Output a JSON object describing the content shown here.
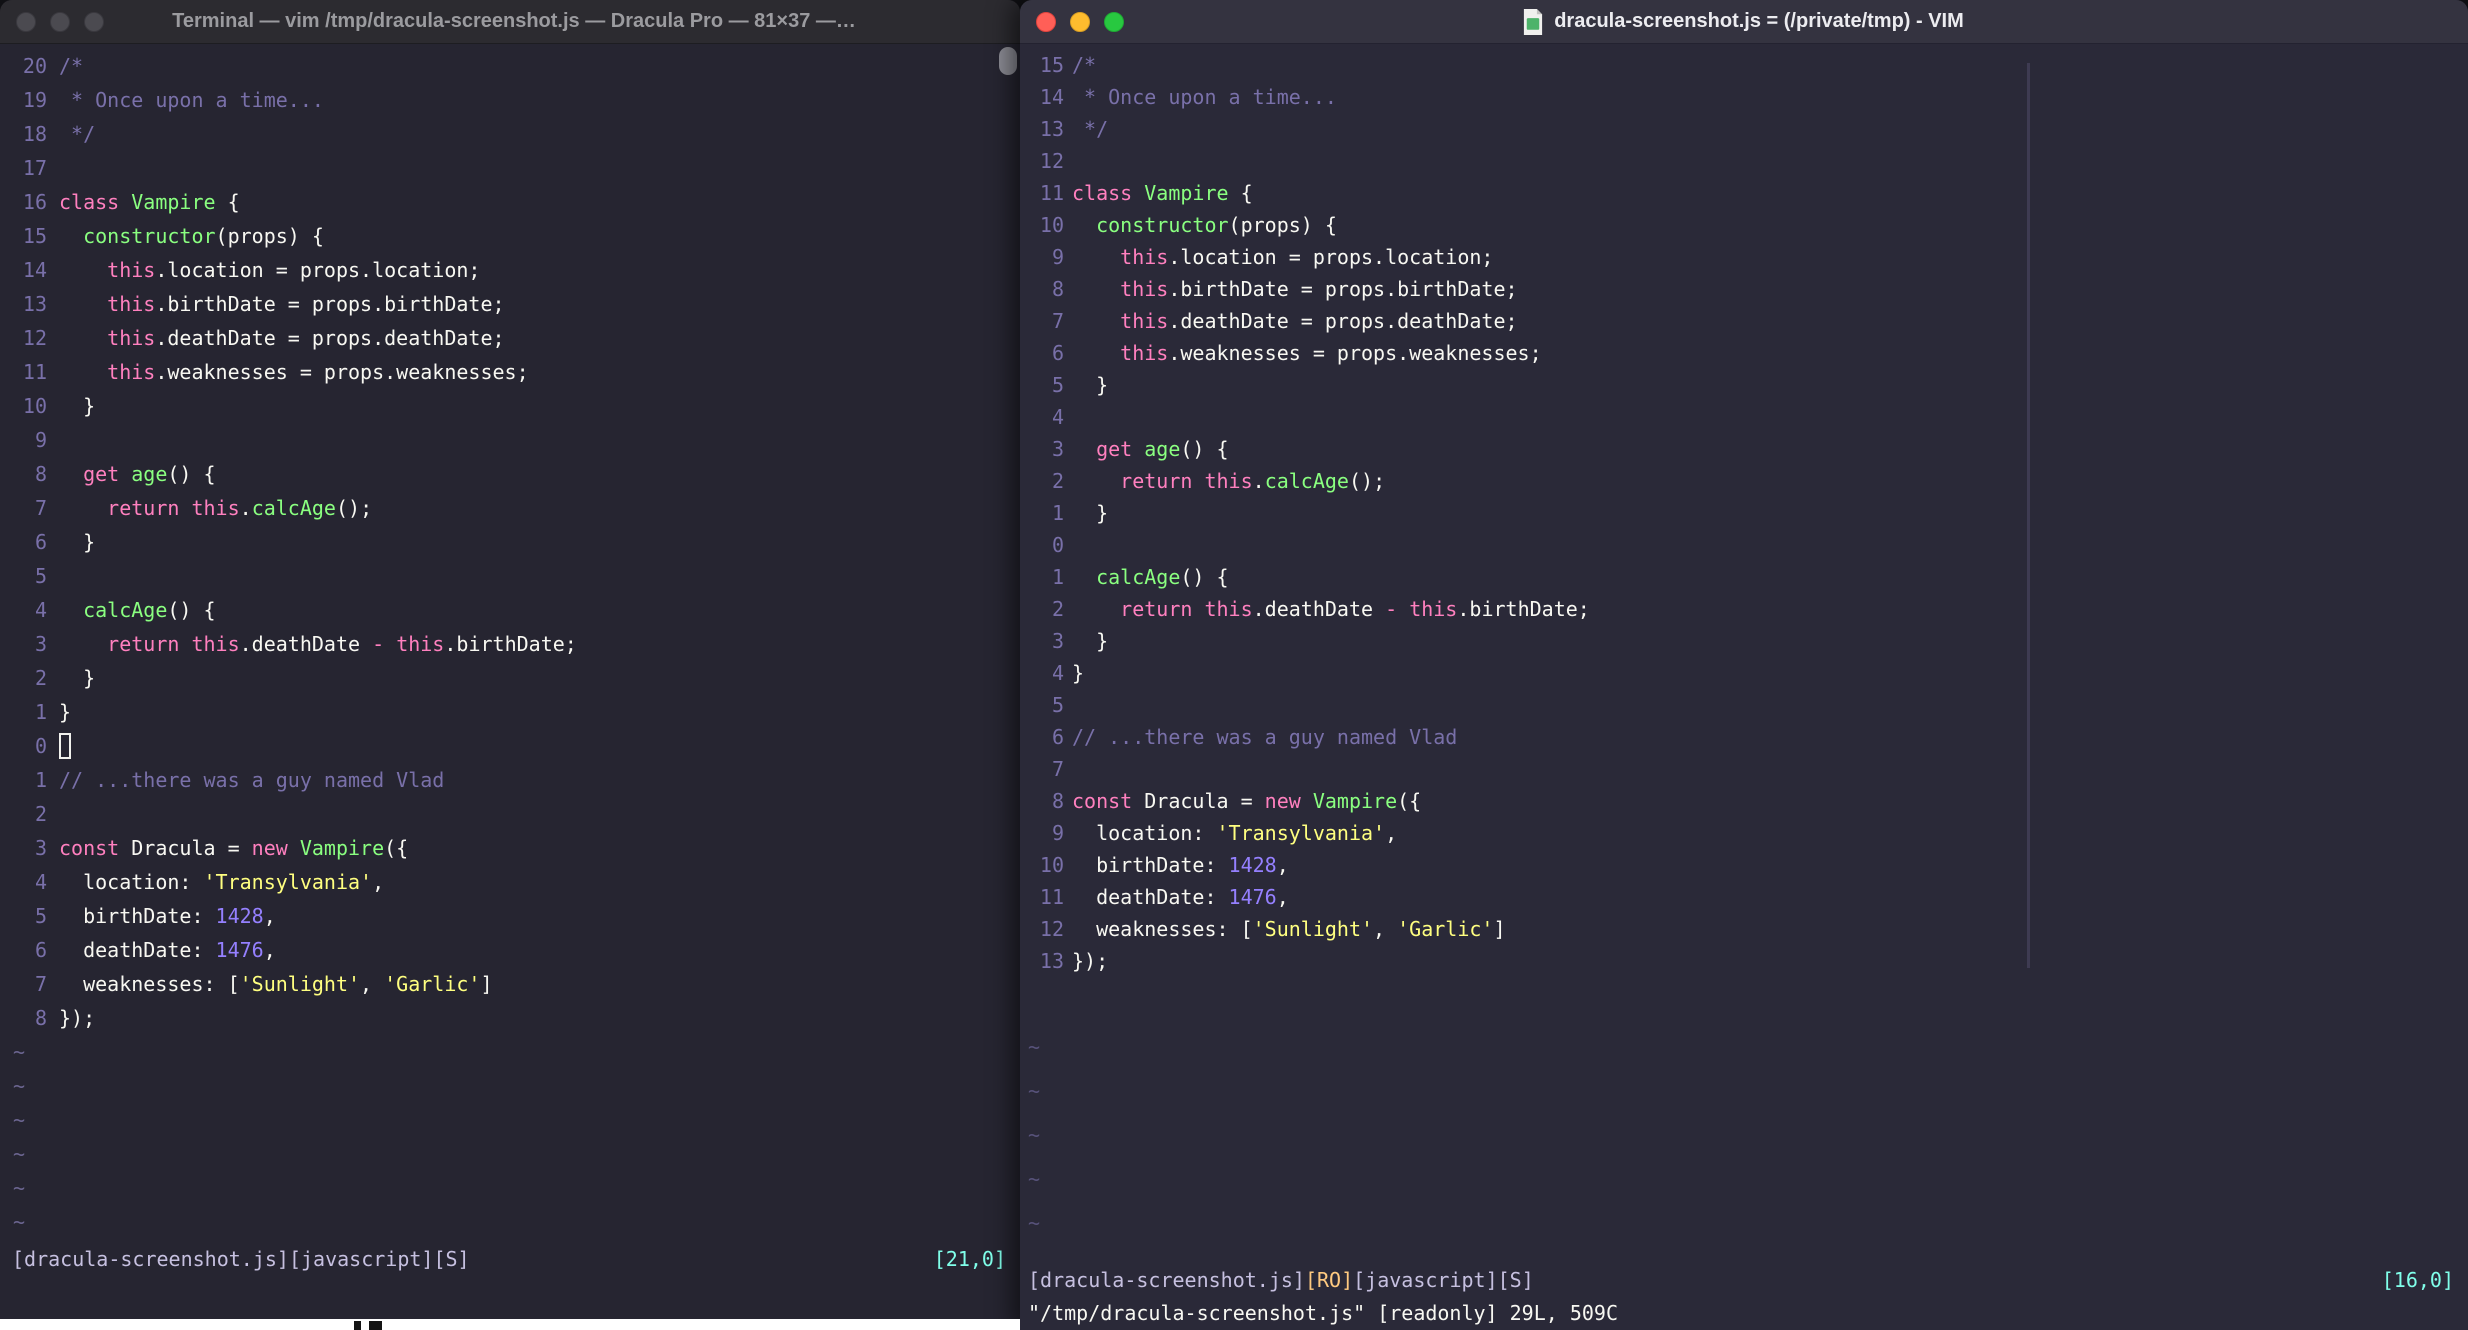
{
  "palette": {
    "background_left": "#262531",
    "background_right": "#2a2938",
    "foreground": "#f8f8f2",
    "comment": "#7970a9",
    "pink": "#ff80bf",
    "green": "#8aff80",
    "yellow": "#ffff80",
    "purple": "#9580ff",
    "cyan": "#80ffea",
    "orange": "#ffca80",
    "line_number": "#7970a9"
  },
  "left_window": {
    "titlebar_title": "Terminal — vim /tmp/dracula-screenshot.js — Dracula Pro — 81×37 —…",
    "position": "[21,0]",
    "status_segments": [
      [
        "st",
        "[dracula-screenshot.js]"
      ],
      [
        "st",
        "[javascript]"
      ],
      [
        "st",
        "[S]"
      ]
    ],
    "lines": [
      {
        "n": "20",
        "s": [
          [
            "c",
            "/*"
          ]
        ]
      },
      {
        "n": "19",
        "s": [
          [
            "c",
            " * Once upon a time..."
          ]
        ]
      },
      {
        "n": "18",
        "s": [
          [
            "c",
            " */"
          ]
        ]
      },
      {
        "n": "17",
        "s": []
      },
      {
        "n": "16",
        "s": [
          [
            "k",
            "class"
          ],
          [
            "t",
            " "
          ],
          [
            "f",
            "Vampire"
          ],
          [
            "t",
            " {"
          ]
        ]
      },
      {
        "n": "15",
        "s": [
          [
            "t",
            "  "
          ],
          [
            "f",
            "constructor"
          ],
          [
            "t",
            "(props) {"
          ]
        ]
      },
      {
        "n": "14",
        "s": [
          [
            "t",
            "    "
          ],
          [
            "k",
            "this"
          ],
          [
            "t",
            ".location = props.location;"
          ]
        ]
      },
      {
        "n": "13",
        "s": [
          [
            "t",
            "    "
          ],
          [
            "k",
            "this"
          ],
          [
            "t",
            ".birthDate = props.birthDate;"
          ]
        ]
      },
      {
        "n": "12",
        "s": [
          [
            "t",
            "    "
          ],
          [
            "k",
            "this"
          ],
          [
            "t",
            ".deathDate = props.deathDate;"
          ]
        ]
      },
      {
        "n": "11",
        "s": [
          [
            "t",
            "    "
          ],
          [
            "k",
            "this"
          ],
          [
            "t",
            ".weaknesses = props.weaknesses;"
          ]
        ]
      },
      {
        "n": "10",
        "s": [
          [
            "t",
            "  }"
          ]
        ]
      },
      {
        "n": "9",
        "s": []
      },
      {
        "n": "8",
        "s": [
          [
            "t",
            "  "
          ],
          [
            "k",
            "get"
          ],
          [
            "t",
            " "
          ],
          [
            "f",
            "age"
          ],
          [
            "t",
            "() {"
          ]
        ]
      },
      {
        "n": "7",
        "s": [
          [
            "t",
            "    "
          ],
          [
            "k",
            "return"
          ],
          [
            "t",
            " "
          ],
          [
            "k",
            "this"
          ],
          [
            "t",
            "."
          ],
          [
            "f",
            "calcAge"
          ],
          [
            "t",
            "();"
          ]
        ]
      },
      {
        "n": "6",
        "s": [
          [
            "t",
            "  }"
          ]
        ]
      },
      {
        "n": "5",
        "s": []
      },
      {
        "n": "4",
        "s": [
          [
            "t",
            "  "
          ],
          [
            "f",
            "calcAge"
          ],
          [
            "t",
            "() {"
          ]
        ]
      },
      {
        "n": "3",
        "s": [
          [
            "t",
            "    "
          ],
          [
            "k",
            "return"
          ],
          [
            "t",
            " "
          ],
          [
            "k",
            "this"
          ],
          [
            "t",
            ".deathDate "
          ],
          [
            "k",
            "-"
          ],
          [
            "t",
            " "
          ],
          [
            "k",
            "this"
          ],
          [
            "t",
            ".birthDate;"
          ]
        ]
      },
      {
        "n": "2",
        "s": [
          [
            "t",
            "  }"
          ]
        ]
      },
      {
        "n": "1",
        "s": [
          [
            "t",
            "}"
          ]
        ]
      },
      {
        "n": "0",
        "s": [],
        "cursor": "hollow"
      },
      {
        "n": "1",
        "s": [
          [
            "c",
            "// ...there was a guy named Vlad"
          ]
        ]
      },
      {
        "n": "2",
        "s": []
      },
      {
        "n": "3",
        "s": [
          [
            "k",
            "const"
          ],
          [
            "t",
            " Dracula = "
          ],
          [
            "k",
            "new"
          ],
          [
            "t",
            " "
          ],
          [
            "f",
            "Vampire"
          ],
          [
            "t",
            "({"
          ]
        ]
      },
      {
        "n": "4",
        "s": [
          [
            "t",
            "  location: "
          ],
          [
            "str",
            "'Transylvania'"
          ],
          [
            "t",
            ","
          ]
        ]
      },
      {
        "n": "5",
        "s": [
          [
            "t",
            "  birthDate: "
          ],
          [
            "num",
            "1428"
          ],
          [
            "t",
            ","
          ]
        ]
      },
      {
        "n": "6",
        "s": [
          [
            "t",
            "  deathDate: "
          ],
          [
            "num",
            "1476"
          ],
          [
            "t",
            ","
          ]
        ]
      },
      {
        "n": "7",
        "s": [
          [
            "t",
            "  weaknesses: ["
          ],
          [
            "str",
            "'Sunlight'"
          ],
          [
            "t",
            ", "
          ],
          [
            "str",
            "'Garlic'"
          ],
          [
            "t",
            "]"
          ]
        ]
      },
      {
        "n": "8",
        "s": [
          [
            "t",
            "});"
          ]
        ]
      },
      {
        "tilde": true
      },
      {
        "tilde": true
      },
      {
        "tilde": true
      },
      {
        "tilde": true
      },
      {
        "tilde": true
      },
      {
        "tilde": true
      }
    ]
  },
  "right_window": {
    "titlebar_title": "dracula-screenshot.js = (/private/tmp) - VIM",
    "position": "[16,0]",
    "status_segments": [
      [
        "st",
        "[dracula-screenshot.js]"
      ],
      [
        "ro",
        "[RO]"
      ],
      [
        "st",
        "[javascript]"
      ],
      [
        "st",
        "[S]"
      ]
    ],
    "cmdline": "\"/tmp/dracula-screenshot.js\" [readonly] 29L, 509C",
    "tilde_count": 5,
    "lines": [
      {
        "n": "15",
        "s": [
          [
            "c",
            "/*"
          ]
        ]
      },
      {
        "n": "14",
        "s": [
          [
            "c",
            " * Once upon a time..."
          ]
        ]
      },
      {
        "n": "13",
        "s": [
          [
            "c",
            " */"
          ]
        ]
      },
      {
        "n": "12",
        "s": []
      },
      {
        "n": "11",
        "s": [
          [
            "k",
            "class"
          ],
          [
            "t",
            " "
          ],
          [
            "f",
            "Vampire"
          ],
          [
            "t",
            " {"
          ]
        ]
      },
      {
        "n": "10",
        "s": [
          [
            "t",
            "  "
          ],
          [
            "f",
            "constructor"
          ],
          [
            "t",
            "(props) {"
          ]
        ]
      },
      {
        "n": "9",
        "s": [
          [
            "t",
            "    "
          ],
          [
            "k",
            "this"
          ],
          [
            "t",
            ".location = props.location;"
          ]
        ]
      },
      {
        "n": "8",
        "s": [
          [
            "t",
            "    "
          ],
          [
            "k",
            "this"
          ],
          [
            "t",
            ".birthDate = props.birthDate;"
          ]
        ]
      },
      {
        "n": "7",
        "s": [
          [
            "t",
            "    "
          ],
          [
            "k",
            "this"
          ],
          [
            "t",
            ".deathDate = props.deathDate;"
          ]
        ]
      },
      {
        "n": "6",
        "s": [
          [
            "t",
            "    "
          ],
          [
            "k",
            "this"
          ],
          [
            "t",
            ".weaknesses = props.weaknesses;"
          ]
        ]
      },
      {
        "n": "5",
        "s": [
          [
            "t",
            "  }"
          ]
        ]
      },
      {
        "n": "4",
        "s": []
      },
      {
        "n": "3",
        "s": [
          [
            "t",
            "  "
          ],
          [
            "k",
            "get"
          ],
          [
            "t",
            " "
          ],
          [
            "f",
            "age"
          ],
          [
            "t",
            "() {"
          ]
        ]
      },
      {
        "n": "2",
        "s": [
          [
            "t",
            "    "
          ],
          [
            "k",
            "return"
          ],
          [
            "t",
            " "
          ],
          [
            "k",
            "this"
          ],
          [
            "t",
            "."
          ],
          [
            "f",
            "calcAge"
          ],
          [
            "t",
            "();"
          ]
        ]
      },
      {
        "n": "1",
        "s": [
          [
            "t",
            "  }"
          ]
        ]
      },
      {
        "n": "0",
        "s": []
      },
      {
        "n": "1",
        "s": [
          [
            "t",
            "  "
          ],
          [
            "f",
            "calcAge"
          ],
          [
            "t",
            "() {"
          ]
        ]
      },
      {
        "n": "2",
        "s": [
          [
            "t",
            "    "
          ],
          [
            "k",
            "return"
          ],
          [
            "t",
            " "
          ],
          [
            "k",
            "this"
          ],
          [
            "t",
            ".deathDate "
          ],
          [
            "k",
            "-"
          ],
          [
            "t",
            " "
          ],
          [
            "k",
            "this"
          ],
          [
            "t",
            ".birthDate;"
          ]
        ]
      },
      {
        "n": "3",
        "s": [
          [
            "t",
            "  }"
          ]
        ]
      },
      {
        "n": "4",
        "s": [
          [
            "t",
            "}"
          ]
        ]
      },
      {
        "n": "5",
        "s": []
      },
      {
        "n": "6",
        "s": [
          [
            "c",
            "// ...there was a guy named Vlad"
          ]
        ]
      },
      {
        "n": "7",
        "s": []
      },
      {
        "n": "8",
        "s": [
          [
            "k",
            "const"
          ],
          [
            "t",
            " Dracula = "
          ],
          [
            "k",
            "new"
          ],
          [
            "t",
            " "
          ],
          [
            "f",
            "Vampire"
          ],
          [
            "t",
            "({"
          ]
        ]
      },
      {
        "n": "9",
        "s": [
          [
            "t",
            "  location: "
          ],
          [
            "str",
            "'Transylvania'"
          ],
          [
            "t",
            ","
          ]
        ]
      },
      {
        "n": "10",
        "s": [
          [
            "t",
            "  birthDate: "
          ],
          [
            "num",
            "1428"
          ],
          [
            "t",
            ","
          ]
        ]
      },
      {
        "n": "11",
        "s": [
          [
            "t",
            "  deathDate: "
          ],
          [
            "num",
            "1476"
          ],
          [
            "t",
            ","
          ]
        ]
      },
      {
        "n": "12",
        "s": [
          [
            "t",
            "  weaknesses: ["
          ],
          [
            "str",
            "'Sunlight'"
          ],
          [
            "t",
            ", "
          ],
          [
            "str",
            "'Garlic'"
          ],
          [
            "t",
            "]"
          ]
        ]
      },
      {
        "n": "13",
        "s": [
          [
            "t",
            "});"
          ]
        ]
      }
    ]
  }
}
